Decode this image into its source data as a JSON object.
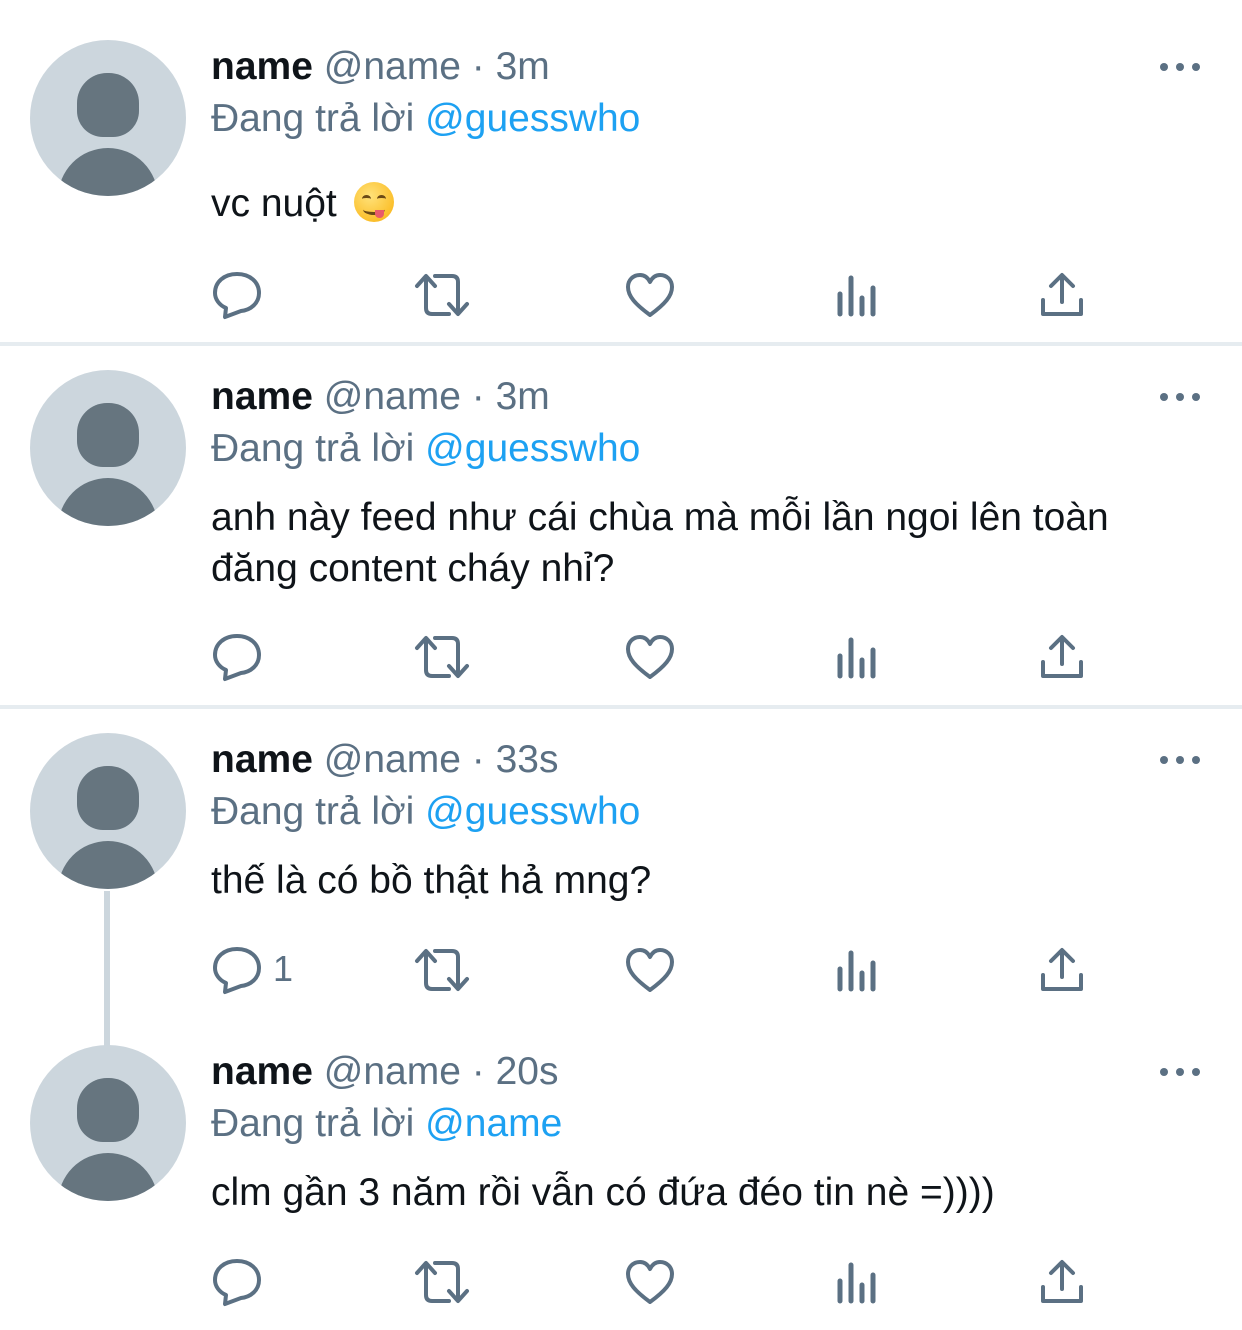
{
  "tweets": [
    {
      "name": "name",
      "handle": "@name",
      "separator": "·",
      "time": "3m",
      "reply_prefix": "Đang trả lời",
      "reply_to": "@guesswho",
      "text": "vc nuột",
      "emoji": "savoring-food-emoji",
      "reply_count": ""
    },
    {
      "name": "name",
      "handle": "@name",
      "separator": "·",
      "time": "3m",
      "reply_prefix": "Đang trả lời",
      "reply_to": "@guesswho",
      "text": "anh này feed như cái chùa mà mỗi lần ngoi lên toàn đăng content cháy nhỉ?",
      "reply_count": ""
    },
    {
      "name": "name",
      "handle": "@name",
      "separator": "·",
      "time": "33s",
      "reply_prefix": "Đang trả lời",
      "reply_to": "@guesswho",
      "text": "thế là có bồ thật hả mng?",
      "reply_count": "1"
    },
    {
      "name": "name",
      "handle": "@name",
      "separator": "·",
      "time": "20s",
      "reply_prefix": "Đang trả lời",
      "reply_to": "@name",
      "text": "clm gần 3 năm rồi vẫn có đứa đéo tin nè =))))",
      "reply_count": ""
    }
  ],
  "icons": [
    "reply-icon",
    "retweet-icon",
    "like-icon",
    "analytics-icon",
    "share-icon",
    "more-icon"
  ],
  "colors": {
    "accent": "#1da1f2",
    "secondary_text": "#5b7083",
    "avatar_bg": "#ccd6dd",
    "avatar_fg": "#66757f",
    "divider": "#e6ecf0"
  }
}
